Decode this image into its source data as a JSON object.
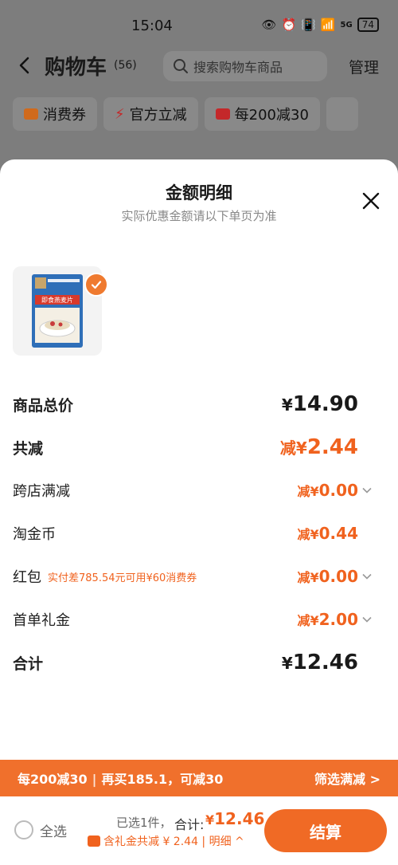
{
  "status": {
    "time": "15:04",
    "battery": "74",
    "network": "5G"
  },
  "header": {
    "title": "购物车",
    "count": "(56)",
    "search_placeholder": "搜索购物车商品",
    "manage": "管理"
  },
  "chips": [
    {
      "label": "消费券",
      "icon": "coupon-icon",
      "color": "#f07a22"
    },
    {
      "label": "官方立减",
      "icon": "lightning-icon",
      "color": "#e8322f"
    },
    {
      "label": "每200减30",
      "icon": "gift-icon",
      "color": "#e8322f"
    }
  ],
  "sheet": {
    "title": "金额明细",
    "subtitle": "实际优惠金额请以下单页为准",
    "product_image_text": "即食燕麦片",
    "rows": {
      "total_price": {
        "label": "商品总价",
        "currency": "¥",
        "value": "14.90"
      },
      "total_discount": {
        "label": "共减",
        "prefix": "减¥",
        "value": "2.44"
      },
      "cross_store": {
        "label": "跨店满减",
        "prefix": "减¥",
        "value": "0.00"
      },
      "taojinbi": {
        "label": "淘金币",
        "prefix": "减¥",
        "value": "0.44"
      },
      "redpacket": {
        "label": "红包",
        "note": "实付差785.54元可用¥60消费券",
        "prefix": "减¥",
        "value": "0.00"
      },
      "first_order": {
        "label": "首单礼金",
        "prefix": "减¥",
        "value": "2.00"
      },
      "sum": {
        "label": "合计",
        "currency": "¥",
        "value": "12.46"
      }
    }
  },
  "promo": {
    "left1": "每200减30",
    "sep": "|",
    "left2": "再买185.1，可减30",
    "right": "筛选满减 >"
  },
  "bottom": {
    "all": "全选",
    "selected": "已选1件，",
    "total_label": "合计:",
    "currency": "¥",
    "total": "12.46",
    "saving": "含礼金共减 ¥ 2.44 | 明细 ^",
    "checkout": "结算"
  },
  "colors": {
    "accent": "#f0621e",
    "promo_bg": "#f0702c"
  }
}
